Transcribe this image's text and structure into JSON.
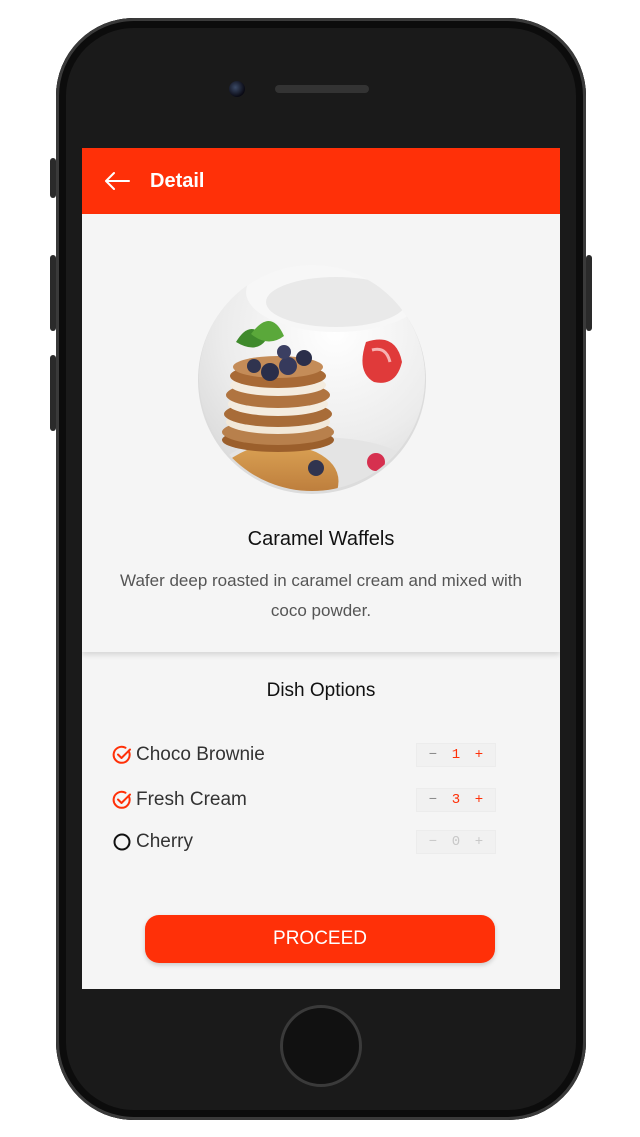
{
  "app_bar": {
    "title": "Detail",
    "back_icon": "arrow-left-icon"
  },
  "dish": {
    "name": "Caramel Waffels",
    "description": "Wafer deep roasted in caramel cream and mixed with coco powder.",
    "image_icon": "pancake-stack-photo"
  },
  "options": {
    "title": "Dish Options",
    "items": [
      {
        "label": "Choco Brownie",
        "selected": true,
        "quantity": "1",
        "minus": "−",
        "plus": "+"
      },
      {
        "label": "Fresh Cream",
        "selected": true,
        "quantity": "3",
        "minus": "−",
        "plus": "+"
      },
      {
        "label": "Cherry",
        "selected": false,
        "quantity": "0",
        "minus": "−",
        "plus": "+"
      }
    ]
  },
  "proceed_label": "PROCEED",
  "colors": {
    "accent": "#ff3008",
    "background": "#f5f5f5",
    "text": "#111111",
    "muted": "#555555"
  }
}
